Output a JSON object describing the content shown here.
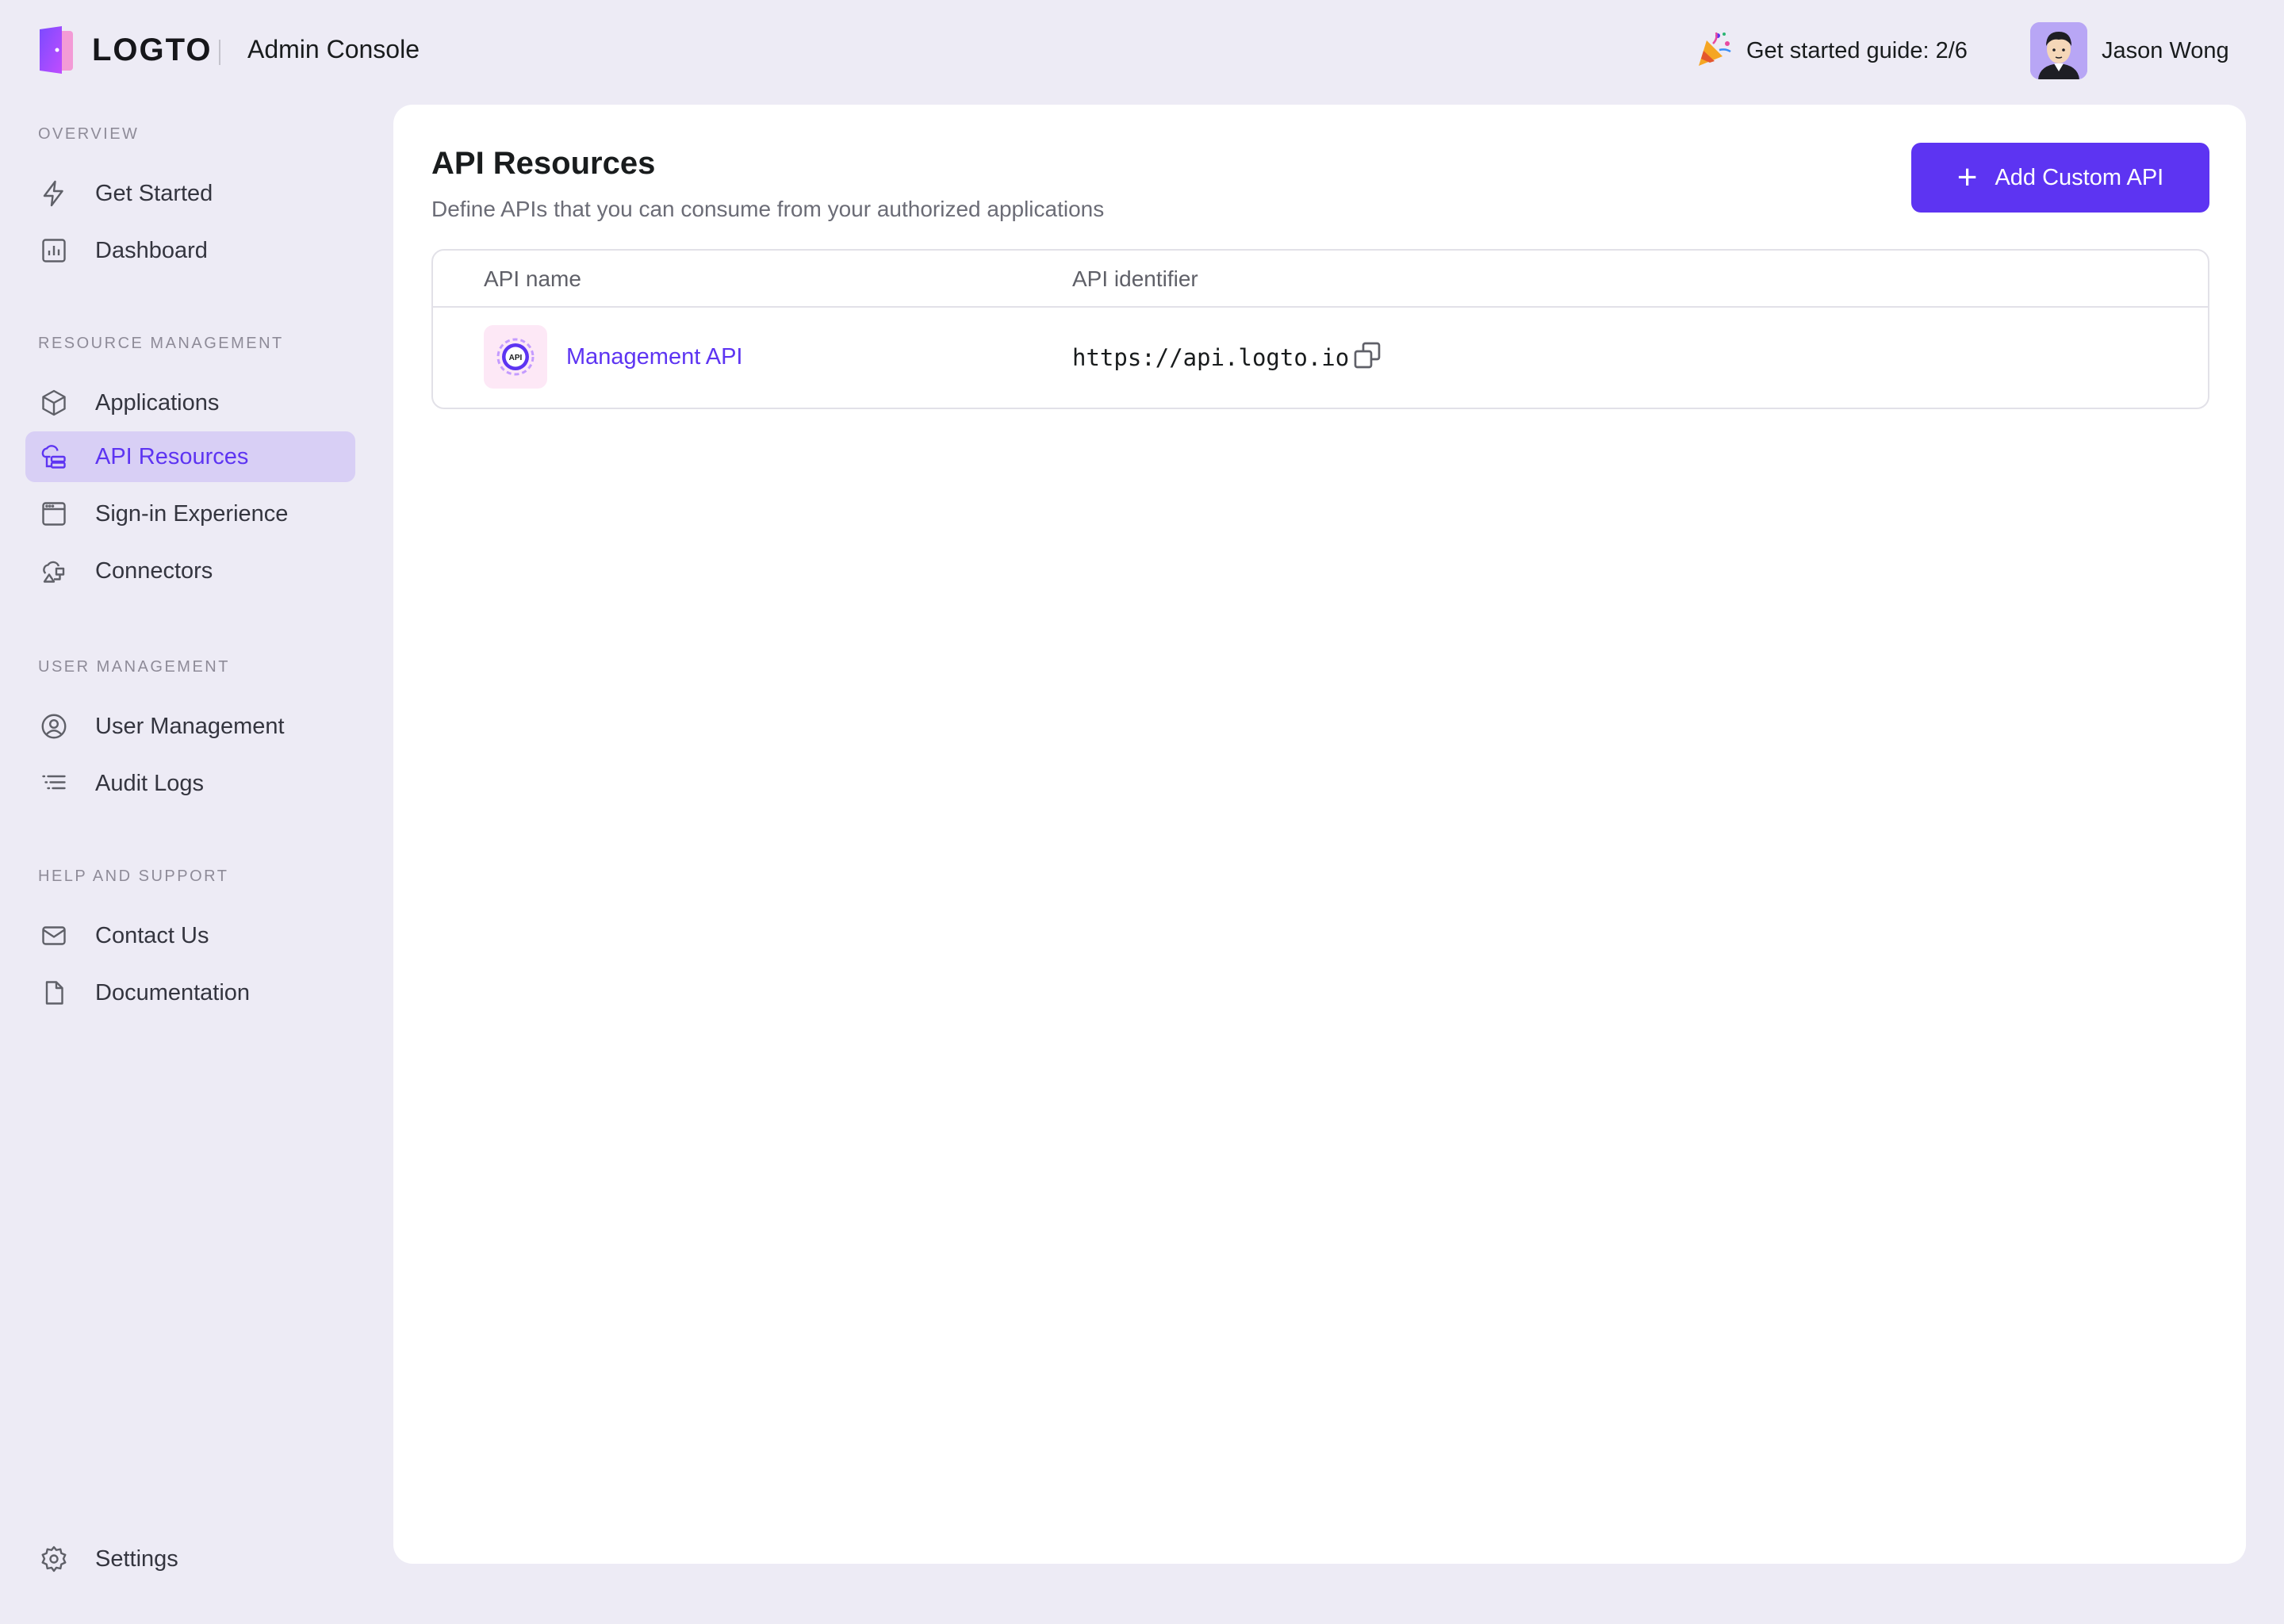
{
  "header": {
    "brand": "LOGTO",
    "console_title": "Admin Console",
    "guide_label": "Get started guide: 2/6",
    "user_name": "Jason Wong"
  },
  "sidebar": {
    "sections": [
      {
        "title": "OVERVIEW",
        "items": [
          {
            "label": "Get Started",
            "icon": "lightning-icon"
          },
          {
            "label": "Dashboard",
            "icon": "bar-chart-icon"
          }
        ]
      },
      {
        "title": "RESOURCE MANAGEMENT",
        "items": [
          {
            "label": "Applications",
            "icon": "box-icon"
          },
          {
            "label": "API Resources",
            "icon": "api-resources-icon",
            "active": true
          },
          {
            "label": "Sign-in Experience",
            "icon": "browser-window-icon"
          },
          {
            "label": "Connectors",
            "icon": "connectors-icon"
          }
        ]
      },
      {
        "title": "USER MANAGEMENT",
        "items": [
          {
            "label": "User Management",
            "icon": "user-circle-icon"
          },
          {
            "label": "Audit Logs",
            "icon": "list-icon"
          }
        ]
      },
      {
        "title": "HELP AND SUPPORT",
        "items": [
          {
            "label": "Contact Us",
            "icon": "mail-icon"
          },
          {
            "label": "Documentation",
            "icon": "document-icon"
          }
        ]
      }
    ],
    "settings_label": "Settings"
  },
  "main": {
    "title": "API Resources",
    "subtitle": "Define APIs that you can consume from your authorized applications",
    "add_button_label": "Add Custom API",
    "table": {
      "columns": [
        "API name",
        "API identifier"
      ],
      "rows": [
        {
          "name": "Management API",
          "identifier": "https://api.logto.io",
          "icon_text": "API"
        }
      ]
    }
  },
  "colors": {
    "accent": "#5d34f2",
    "background": "#edebf5",
    "active_nav_bg": "#d8cff5"
  }
}
